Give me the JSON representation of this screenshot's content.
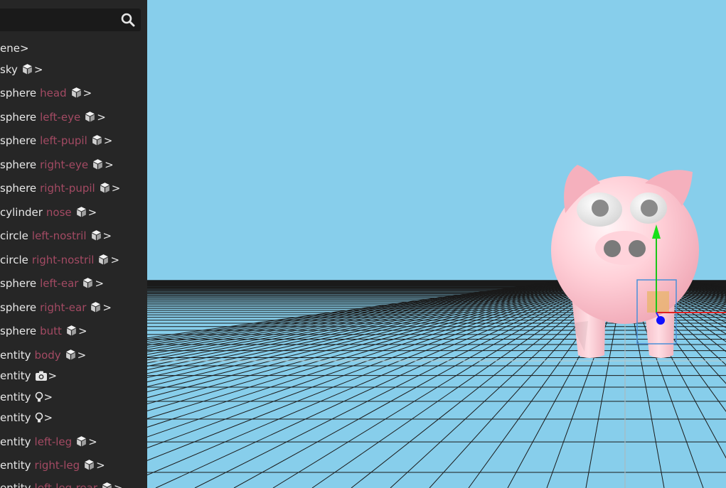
{
  "search": {
    "icon": "search-icon"
  },
  "tree": [
    {
      "tag": "ene>",
      "id": "",
      "icon": ""
    },
    {
      "tag": "sky",
      "id": "",
      "icon": "cube-icon"
    },
    {
      "tag": "sphere",
      "id": "head",
      "icon": "cube-icon"
    },
    {
      "tag": "sphere",
      "id": "left-eye",
      "icon": "cube-icon"
    },
    {
      "tag": "sphere",
      "id": "left-pupil",
      "icon": "cube-icon"
    },
    {
      "tag": "sphere",
      "id": "right-eye",
      "icon": "cube-icon"
    },
    {
      "tag": "sphere",
      "id": "right-pupil",
      "icon": "cube-icon"
    },
    {
      "tag": "cylinder",
      "id": "nose",
      "icon": "cube-icon"
    },
    {
      "tag": "circle",
      "id": "left-nostril",
      "icon": "cube-icon"
    },
    {
      "tag": "circle",
      "id": "right-nostril",
      "icon": "cube-icon"
    },
    {
      "tag": "sphere",
      "id": "left-ear",
      "icon": "cube-icon"
    },
    {
      "tag": "sphere",
      "id": "right-ear",
      "icon": "cube-icon"
    },
    {
      "tag": "sphere",
      "id": "butt",
      "icon": "cube-icon"
    },
    {
      "tag": "entity",
      "id": "body",
      "icon": "cube-icon"
    },
    {
      "tag": "entity",
      "id": "",
      "icon": "camera-icon"
    },
    {
      "tag": "entity",
      "id": "",
      "icon": "lightbulb-icon"
    },
    {
      "tag": "entity",
      "id": "",
      "icon": "lightbulb-icon"
    },
    {
      "tag": "entity",
      "id": "left-leg",
      "icon": "cube-icon"
    },
    {
      "tag": "entity",
      "id": "right-leg",
      "icon": "cube-icon"
    },
    {
      "tag": "entity",
      "id": "left-leg-rear",
      "icon": "cube-icon"
    }
  ],
  "colors": {
    "sky": "#87ceeb",
    "panel": "#262626",
    "id_text": "#a34a63",
    "pig": "#ffc6d0"
  }
}
